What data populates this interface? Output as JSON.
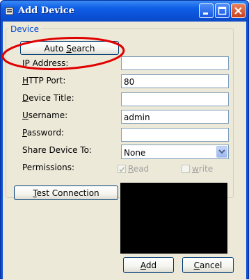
{
  "window": {
    "title": "Add Device",
    "controls": [
      "minimize-icon",
      "maximize-icon",
      "close-icon"
    ]
  },
  "group": {
    "title": "Device"
  },
  "buttons": {
    "auto_search_pre": "Auto ",
    "auto_search_key": "S",
    "auto_search_post": "earch",
    "test_key": "T",
    "test_post": "est Connection",
    "add_key": "A",
    "add_post": "dd",
    "cancel_key": "C",
    "cancel_post": "ancel"
  },
  "fields": {
    "ip": {
      "key": "I",
      "rest": "P Address:",
      "value": ""
    },
    "port": {
      "key": "H",
      "rest": "TTP Port:",
      "value": "80"
    },
    "title": {
      "key": "D",
      "rest": "evice Title:",
      "value": ""
    },
    "username": {
      "key": "U",
      "rest": "sername:",
      "value": "admin"
    },
    "password": {
      "key": "P",
      "rest": "assword:",
      "value": ""
    },
    "share": {
      "label": "Share Device To:",
      "value": "None"
    },
    "permissions": {
      "label": "Permissions:",
      "read": {
        "key": "R",
        "rest": "ead",
        "checked": true
      },
      "write": {
        "key": "w",
        "rest": "rite",
        "checked": false
      }
    }
  },
  "colors": {
    "title_bar": "#0a53d6",
    "group_title": "#0046d5",
    "client_bg": "#ece9d8",
    "annotation": "#e00000",
    "preview_bg": "#000000"
  }
}
